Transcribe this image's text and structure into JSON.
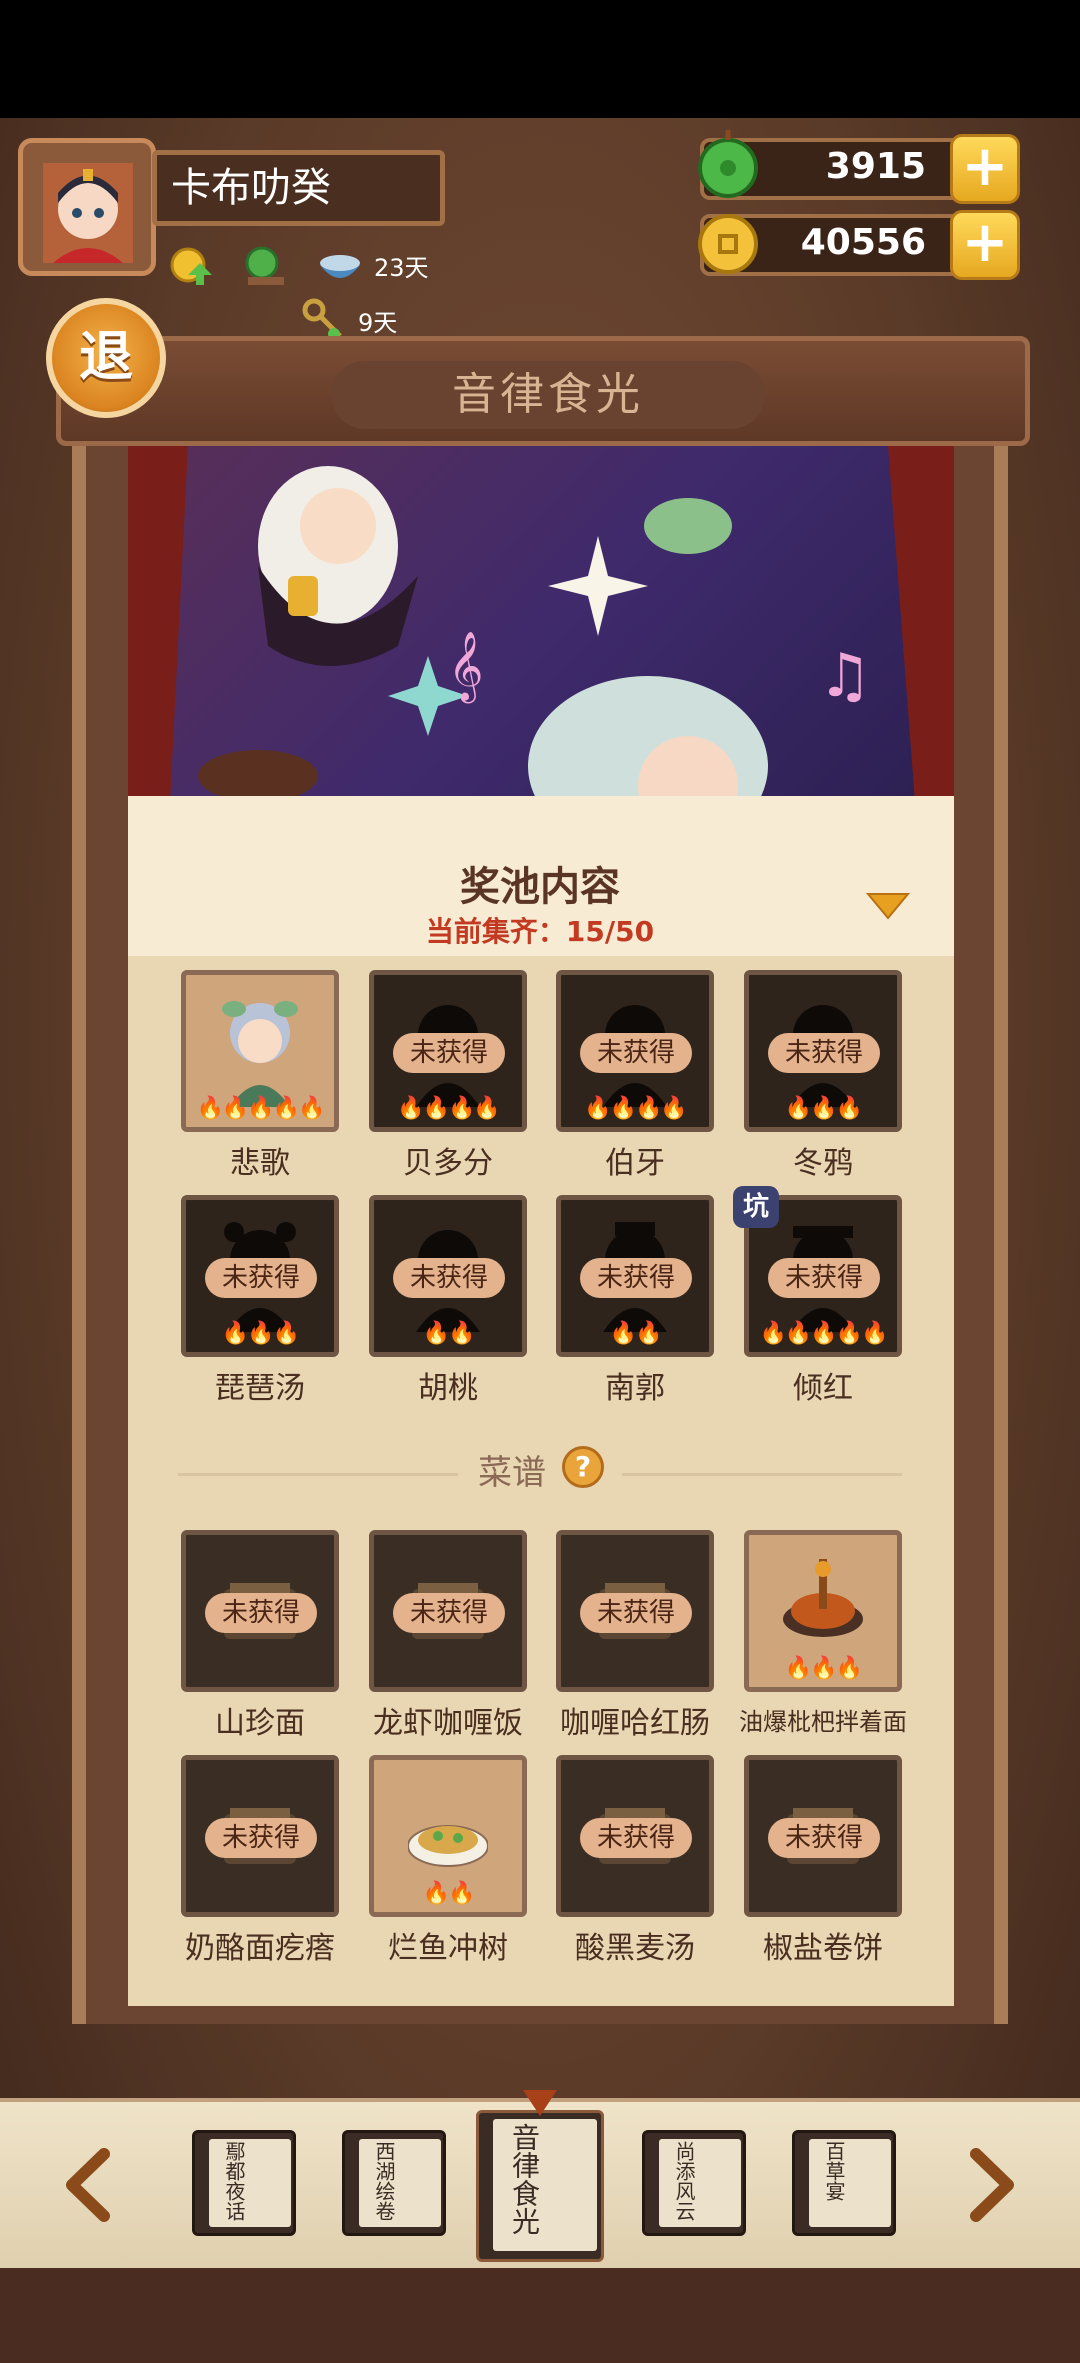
{
  "player": {
    "name": "卡布叻癸",
    "buff_days_1": "23天",
    "buff_days_2": "9天"
  },
  "currency": {
    "jade": "3915",
    "coins": "40556",
    "plus": "+"
  },
  "back_label": "退",
  "page_title": "音律食光",
  "pool": {
    "title": "奖池内容",
    "collect": "当前集齐：15/50",
    "not_obtained": "未获得",
    "pit": "坑",
    "characters": [
      {
        "name": "悲歌",
        "owned": true,
        "flames": "🔥🔥🔥🔥🔥"
      },
      {
        "name": "贝多分",
        "owned": false,
        "flames": "🔥🔥🔥🔥"
      },
      {
        "name": "伯牙",
        "owned": false,
        "flames": "🔥🔥🔥🔥"
      },
      {
        "name": "冬鸦",
        "owned": false,
        "flames": "🔥🔥🔥"
      },
      {
        "name": "琵琶汤",
        "owned": false,
        "flames": "🔥🔥🔥"
      },
      {
        "name": "胡桃",
        "owned": false,
        "flames": "🔥🔥"
      },
      {
        "name": "南郭",
        "owned": false,
        "flames": "🔥🔥"
      },
      {
        "name": "倾红",
        "owned": false,
        "flames": "🔥🔥🔥🔥🔥"
      }
    ]
  },
  "recipes": {
    "title": "菜谱",
    "help": "?",
    "items": [
      {
        "name": "山珍面",
        "owned": false
      },
      {
        "name": "龙虾咖喱饭",
        "owned": false
      },
      {
        "name": "咖喱哈红肠",
        "owned": false
      },
      {
        "name": "油爆枇杷拌着面",
        "owned": true,
        "flames": "🔥🔥🔥"
      },
      {
        "name": "奶酪面疙瘩",
        "owned": false
      },
      {
        "name": "烂鱼冲树",
        "owned": true,
        "flames": "🔥🔥"
      },
      {
        "name": "酸黑麦汤",
        "owned": false
      },
      {
        "name": "椒盐卷饼",
        "owned": false
      }
    ]
  },
  "bottom_nav": {
    "books": [
      "鄢都夜话",
      "西湖绘卷",
      "音律食光",
      "尚添风云",
      "百草宴"
    ]
  },
  "colors": {
    "accent_red": "#c33a22",
    "gold": "#ffd95a",
    "panel": "#efe1c4"
  }
}
